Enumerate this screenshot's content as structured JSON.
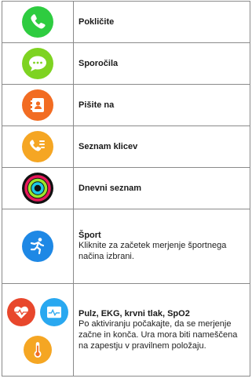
{
  "rows": [
    {
      "icon": "phone-icon",
      "title": "Pokličite"
    },
    {
      "icon": "message-icon",
      "title": "Sporočila"
    },
    {
      "icon": "contacts-icon",
      "title": "Pišite na"
    },
    {
      "icon": "call-list-icon",
      "title": "Seznam klicev"
    },
    {
      "icon": "activity-rings-icon",
      "title": "Dnevni seznam"
    },
    {
      "icon": "running-icon",
      "title": "Šport",
      "desc": "Kliknite za začetek merjenje športnega načina izbrani."
    },
    {
      "icons": [
        "heart-rate-icon",
        "ecg-icon",
        "thermometer-icon"
      ],
      "title": "Pulz, EKG, krvni tlak, SpO2",
      "desc": "Po aktiviranju počakajte, da se merjenje začne in konča. Ura mora biti nameščena na zapestju v pravilnem položaju."
    }
  ],
  "colors": {
    "phone": "#2ecc40",
    "message": "#7ed321",
    "contacts": "#f26c22",
    "call_list": "#f5a623",
    "running": "#1e88e5",
    "heart": "#e8472c",
    "ecg": "#29a8f0",
    "thermo": "#f5a623"
  }
}
